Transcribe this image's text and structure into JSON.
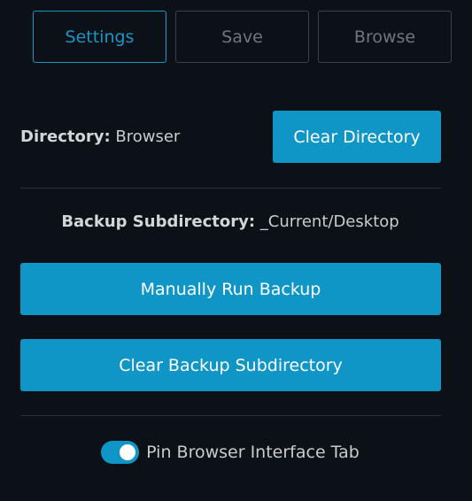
{
  "tabs": [
    {
      "label": "Settings",
      "active": true
    },
    {
      "label": "Save",
      "active": false
    },
    {
      "label": "Browse",
      "active": false
    }
  ],
  "directory": {
    "label": "Directory:",
    "value": "Browser",
    "clear_label": "Clear Directory"
  },
  "backup": {
    "label": "Backup Subdirectory:",
    "value": "_Current/Desktop",
    "run_label": "Manually Run Backup",
    "clear_label": "Clear Backup Subdirectory"
  },
  "pin": {
    "label": "Pin Browser Interface Tab",
    "enabled": true
  },
  "colors": {
    "accent": "#1096c6",
    "background": "#0b1117"
  }
}
